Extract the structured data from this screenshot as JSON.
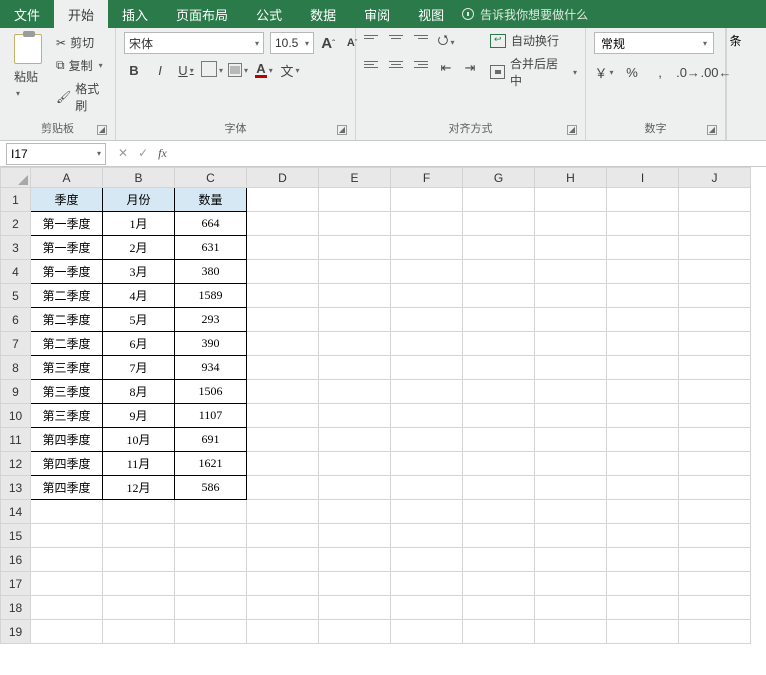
{
  "tabs": [
    "文件",
    "开始",
    "插入",
    "页面布局",
    "公式",
    "数据",
    "审阅",
    "视图"
  ],
  "active_tab": 1,
  "tell_me": "告诉我你想要做什么",
  "clipboard": {
    "title": "剪贴板",
    "paste": "粘贴",
    "cut": "剪切",
    "copy": "复制",
    "format_painter": "格式刷"
  },
  "font": {
    "title": "字体",
    "name": "宋体",
    "size": "10.5",
    "bold": "B",
    "italic": "I",
    "underline": "U",
    "grow": "A",
    "shrink": "A",
    "color_lbl": "A",
    "wen": "文"
  },
  "alignment": {
    "title": "对齐方式",
    "wrap": "自动换行",
    "merge": "合并后居中"
  },
  "number": {
    "title": "数字",
    "format": "常规",
    "currency": "￥",
    "percent": "%",
    "comma": ","
  },
  "right_strip": "条",
  "namebox": "I17",
  "fx": "fx",
  "columns": [
    "A",
    "B",
    "C",
    "D",
    "E",
    "F",
    "G",
    "H",
    "I",
    "J"
  ],
  "rows": 19,
  "table": {
    "headers": [
      "季度",
      "月份",
      "数量"
    ],
    "rows": [
      [
        "第一季度",
        "1月",
        "664"
      ],
      [
        "第一季度",
        "2月",
        "631"
      ],
      [
        "第一季度",
        "3月",
        "380"
      ],
      [
        "第二季度",
        "4月",
        "1589"
      ],
      [
        "第二季度",
        "5月",
        "293"
      ],
      [
        "第二季度",
        "6月",
        "390"
      ],
      [
        "第三季度",
        "7月",
        "934"
      ],
      [
        "第三季度",
        "8月",
        "1506"
      ],
      [
        "第三季度",
        "9月",
        "1107"
      ],
      [
        "第四季度",
        "10月",
        "691"
      ],
      [
        "第四季度",
        "11月",
        "1621"
      ],
      [
        "第四季度",
        "12月",
        "586"
      ]
    ]
  }
}
